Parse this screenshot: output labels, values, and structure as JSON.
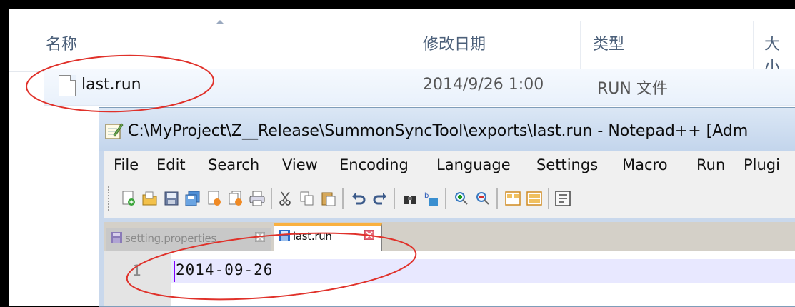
{
  "explorer": {
    "columns": {
      "name": "名称",
      "modified": "修改日期",
      "type": "类型",
      "size": "大小"
    },
    "file": {
      "name": "last.run",
      "modified": "2014/9/26 1:00",
      "type": "RUN 文件"
    }
  },
  "notepad": {
    "title": "C:\\MyProject\\Z__Release\\SummonSyncTool\\exports\\last.run - Notepad++ [Adm",
    "menu": [
      "File",
      "Edit",
      "Search",
      "View",
      "Encoding",
      "Language",
      "Settings",
      "Macro",
      "Run",
      "Plugi"
    ],
    "tabs": [
      {
        "label": "setting.properties",
        "active": false
      },
      {
        "label": "last.run",
        "active": true
      }
    ],
    "editor": {
      "line_number": "1",
      "content": "2014-09-26"
    }
  },
  "colors": {
    "annotation_red": "#e0312a",
    "active_tab_accent": "#fab13f",
    "current_line": "#e8e8ff"
  }
}
